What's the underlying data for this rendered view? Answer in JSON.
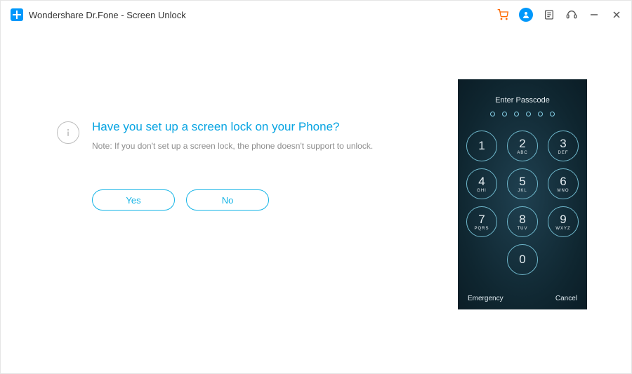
{
  "titlebar": {
    "app_title": "Wondershare Dr.Fone - Screen Unlock"
  },
  "main": {
    "headline": "Have you set up a screen lock on your Phone?",
    "note": "Note: If you don't set up a screen lock, the phone doesn't support to unlock.",
    "yes_label": "Yes",
    "no_label": "No"
  },
  "phone": {
    "enter_passcode": "Enter Passcode",
    "emergency": "Emergency",
    "cancel": "Cancel",
    "keys": {
      "k1": {
        "num": "1",
        "ltr": ""
      },
      "k2": {
        "num": "2",
        "ltr": "ABC"
      },
      "k3": {
        "num": "3",
        "ltr": "DEF"
      },
      "k4": {
        "num": "4",
        "ltr": "GHI"
      },
      "k5": {
        "num": "5",
        "ltr": "JKL"
      },
      "k6": {
        "num": "6",
        "ltr": "MNO"
      },
      "k7": {
        "num": "7",
        "ltr": "PQRS"
      },
      "k8": {
        "num": "8",
        "ltr": "TUV"
      },
      "k9": {
        "num": "9",
        "ltr": "WXYZ"
      },
      "k0": {
        "num": "0",
        "ltr": ""
      }
    }
  }
}
